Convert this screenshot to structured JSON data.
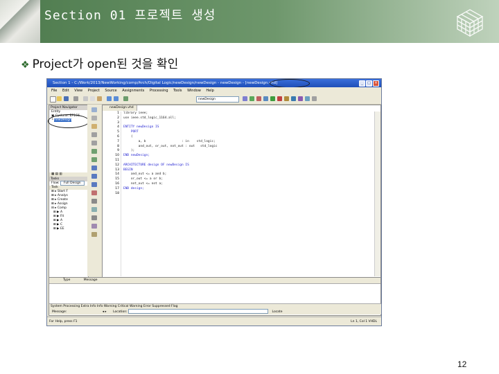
{
  "slide": {
    "section_title": "Section 01 프로젝트 생성",
    "bullet": "Project가 open된 것을 확인",
    "page_number": "12"
  },
  "window": {
    "title": "Section 1 - C:/Work/2013/NewWorking/comp/Arch/Digital Logic/newDesign/newDesign - newDesign - [newDesign.vhd]",
    "controls": [
      "_",
      "□",
      "×"
    ]
  },
  "menu": [
    "File",
    "Edit",
    "View",
    "Project",
    "Source",
    "Assignments",
    "Processing",
    "Tools",
    "Window",
    "Help"
  ],
  "toolbar": {
    "combo_value": "newDesign"
  },
  "project_navigator": {
    "header": "Project Navigator",
    "tab": "Entity",
    "items": [
      "Cyclone: EP1C6",
      "newDesign"
    ]
  },
  "tasks": {
    "header": "Tasks",
    "flow_label": "Flow:",
    "flow_value": "Full Design",
    "column": "Task",
    "items": [
      "Start F",
      "Analys",
      "Create",
      "Assign",
      "Comp",
      "A",
      "Fit",
      "A",
      "C",
      "EE"
    ]
  },
  "editor": {
    "tab_label": "newDesign.vhd",
    "lines": [
      "library ieee;",
      "use ieee.std_logic_1164.all;",
      "",
      "ENTITY newDesign IS",
      "    PORT",
      "    (",
      "        a, b                   : in    std_logic;",
      "        and_out, or_out, not_out : out   std_logic",
      "    );",
      "END newDesign;",
      "",
      "ARCHITECTURE design OF newDesign IS",
      "BEGIN",
      "    and_out <= a and b;",
      "    or_out <= a or b;",
      "    not_out <= not a;",
      "END design;",
      ""
    ]
  },
  "messages": {
    "columns": [
      "Type",
      "Message"
    ],
    "tabs": "System  Processing  Extra Info  Info  Warning  Critical Warning  Error  Suppressed  Flag",
    "message_label": "Message:",
    "location_label": "Location:",
    "locate_label": "Locate"
  },
  "status": {
    "help_text": "For Help, press F1",
    "right_text": "Ln 1, Col 1    VHDL"
  },
  "colors": {
    "banner_green": "#4d7a4d",
    "xp_blue": "#1f4fb8",
    "selection": "#316ac5",
    "keyword": "#1a1ad0"
  }
}
